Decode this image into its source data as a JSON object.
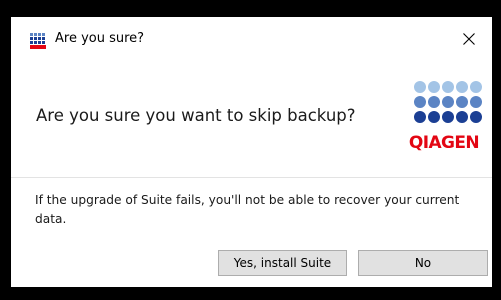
{
  "window": {
    "title": "Are you sure?",
    "icon": "qiagen-app-icon",
    "close_icon": "close-icon"
  },
  "message": {
    "question": "Are you sure you want to skip backup?",
    "warning": "If the upgrade of Suite fails, you'll not be able to recover your current data."
  },
  "logo": {
    "text": "QIAGEN",
    "colors": {
      "light_dots": "#a3c4e6",
      "mid_dots": "#5b84c4",
      "dark_dots": "#1b3f94",
      "wordmark": "#e30613"
    }
  },
  "buttons": {
    "confirm_label": "Yes, install Suite",
    "cancel_label": "No"
  },
  "colors": {
    "background": "#000000",
    "dialog": "#ffffff",
    "button_face": "#e1e1e1",
    "button_border": "#adadad"
  }
}
